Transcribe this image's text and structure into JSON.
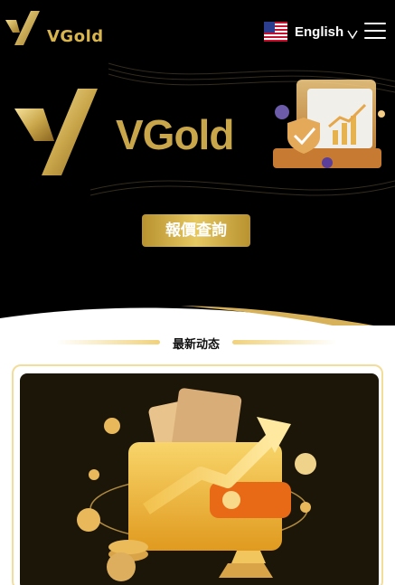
{
  "header": {
    "logo_text": "VGold",
    "language_label": "English",
    "flag_icon": "us-flag-icon",
    "menu_icon": "hamburger-menu-icon"
  },
  "hero": {
    "logo_text": "VGold",
    "illustration": "finance-shield-chart-illustration"
  },
  "quote_button": {
    "label": "報價查詢"
  },
  "news_section": {
    "title": "最新动态"
  },
  "card": {
    "illustration": "gold-wallet-growth-illustration"
  },
  "colors": {
    "background": "#000000",
    "gold": "#d9b54d",
    "gold_light": "#f1d27a",
    "card_dark": "#1c1609"
  }
}
